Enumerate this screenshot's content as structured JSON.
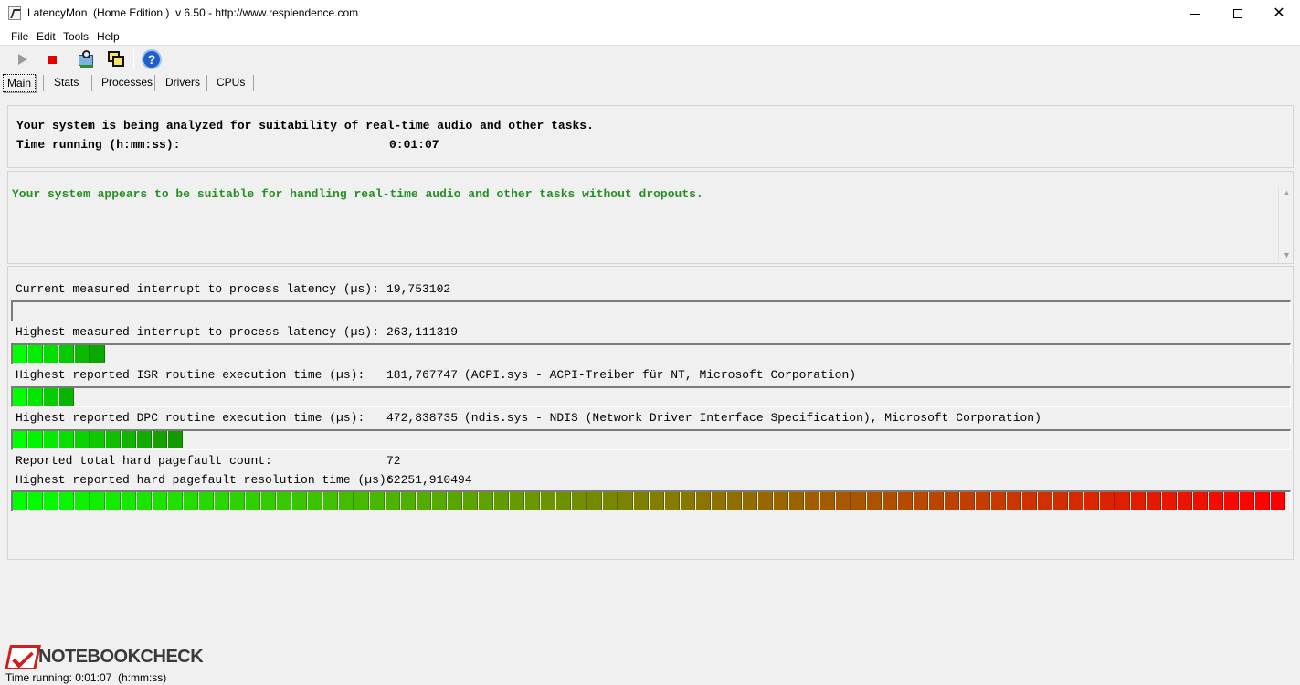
{
  "window": {
    "title": "LatencyMon  (Home Edition )  v 6.50 - http://www.resplendence.com",
    "minimize_glyph": "—",
    "close_glyph": "✕"
  },
  "menu": [
    "File",
    "Edit",
    "Tools",
    "Help"
  ],
  "toolbar": {
    "icons": [
      "play-icon",
      "stop-icon",
      "analyze-icon",
      "windows-icon",
      "help-icon"
    ],
    "help_glyph": "?"
  },
  "tabs": [
    "Main",
    "Stats",
    "Processes",
    "Drivers",
    "CPUs"
  ],
  "status_panel": {
    "line1": "Your system is being analyzed for suitability of real-time audio and other tasks.",
    "time_label": "Time running (h:mm:ss):",
    "time_value": "0:01:07"
  },
  "verdict": {
    "text": "Your system appears to be suitable for handling real-time audio and other tasks without dropouts.",
    "color": "#239023"
  },
  "metrics": [
    {
      "label": "Current measured interrupt to process latency (µs):",
      "value": "19,753102",
      "extra": "",
      "cells": 0
    },
    {
      "label": "Highest measured interrupt to process latency (µs):",
      "value": "263,111319",
      "extra": "",
      "cells": 6
    },
    {
      "label": "Highest reported ISR routine execution time (µs):",
      "value": "181,767747",
      "extra": "(ACPI.sys - ACPI-Treiber für NT, Microsoft Corporation)",
      "cells": 4
    },
    {
      "label": "Highest reported DPC routine execution time (µs):",
      "value": "472,838735",
      "extra": "(ndis.sys - NDIS (Network Driver Interface Specification), Microsoft Corporation)",
      "cells": 11
    },
    {
      "label": "Reported total hard pagefault count:",
      "value": "72",
      "extra": ""
    },
    {
      "label": "Highest reported hard pagefault resolution time (µs):",
      "value": "62251,910494",
      "extra": "",
      "cells": 82
    }
  ],
  "meter_colors": {
    "start": "#00ff00",
    "end": "#ff0000"
  },
  "watermark": "NOTEBOOKCHECK",
  "statusbar": "Time running: 0:01:07  (h:mm:ss)"
}
